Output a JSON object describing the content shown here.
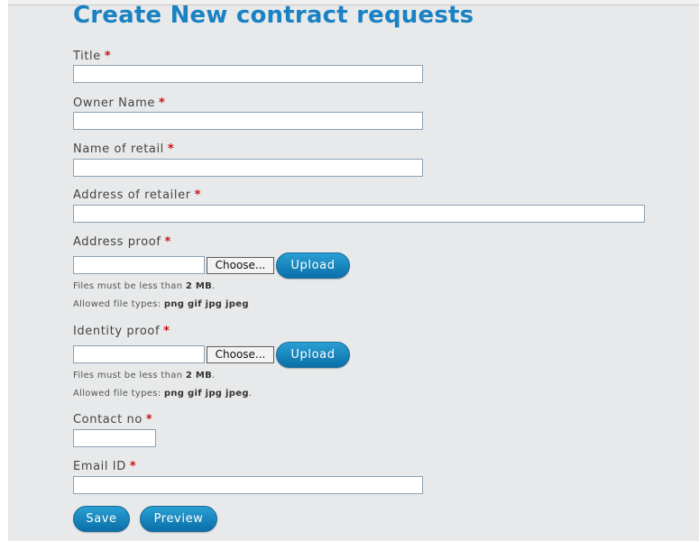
{
  "page": {
    "title": "Create New contract requests",
    "required_marker": "*"
  },
  "form": {
    "title_label": "Title",
    "owner_label": "Owner Name",
    "retail_label": "Name of retail",
    "address_label": "Address of retailer",
    "address_proof_label": "Address proof",
    "identity_proof_label": "Identity proof",
    "contact_label": "Contact no",
    "email_label": "Email ID",
    "choose_label": "Choose...",
    "upload_label": "Upload",
    "help_size_prefix": "Files must be less than",
    "help_size_value": "2 MB",
    "help_types_prefix": "Allowed file types:",
    "help_types_value": "png gif jpg jpeg",
    "title_value": "",
    "owner_value": "",
    "retail_value": "",
    "address_value": "",
    "address_proof_value": "",
    "identity_proof_value": "",
    "contact_value": "",
    "email_value": ""
  },
  "actions": {
    "save_label": "Save",
    "preview_label": "Preview"
  },
  "colors": {
    "heading": "#1a82c3",
    "button": "#0a7fbd",
    "required": "#cc1111"
  }
}
